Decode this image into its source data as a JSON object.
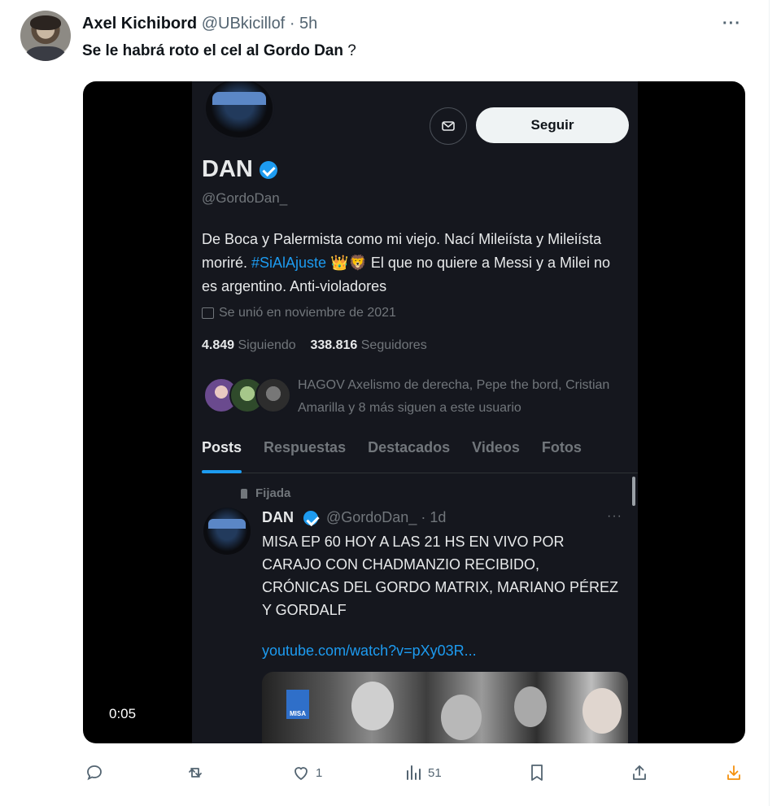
{
  "tweet": {
    "author_name": "Axel Kichibord",
    "author_handle": "@UBkicillof",
    "separator": "·",
    "time": "5h",
    "text": "Se le habrá roto el cel al Gordo Dan",
    "text_suffix": "?",
    "more": "···"
  },
  "video": {
    "timer": "0:05",
    "profile": {
      "follow_label": "Seguir",
      "name": "DAN",
      "handle": "@GordoDan_",
      "bio_1": "De Boca y Palermista como mi viejo. Nací Mileiísta y Mileiísta moriré. ",
      "bio_tag": "#SiAlAjuste",
      "bio_emoji": " 👑🦁 ",
      "bio_2": "El que no quiere a Messi y a Milei no es argentino. Anti-violadores",
      "joined": "Se unió en noviembre de 2021",
      "following_count": "4.849",
      "following_label": "Siguiendo",
      "followers_count": "338.816",
      "followers_label": "Seguidores",
      "followed_by": "HAGOV Axelismo de derecha, Pepe the bord, Cristian Amarilla y 8 más siguen a este usuario",
      "tabs": [
        "Posts",
        "Respuestas",
        "Destacados",
        "Videos",
        "Fotos"
      ]
    },
    "post": {
      "pinned": "Fijada",
      "name": "DAN",
      "handle_time": "@GordoDan_ · 1d",
      "more": "···",
      "text": "MISA EP 60 HOY A LAS 21 HS EN VIVO POR CARAJO CON CHADMANZIO RECIBIDO, CRÓNICAS DEL GORDO MATRIX, MARIANO PÉREZ Y GORDALF",
      "link": "youtube.com/watch?v=pXy03R...",
      "image_logo": "MISA"
    }
  },
  "actions": {
    "reply_count": "",
    "retweet_count": "",
    "like_count": "1",
    "views_count": "51"
  },
  "colors": {
    "accent": "#1d9bf0",
    "share_accent": "#f4900c",
    "muted": "#536471"
  }
}
